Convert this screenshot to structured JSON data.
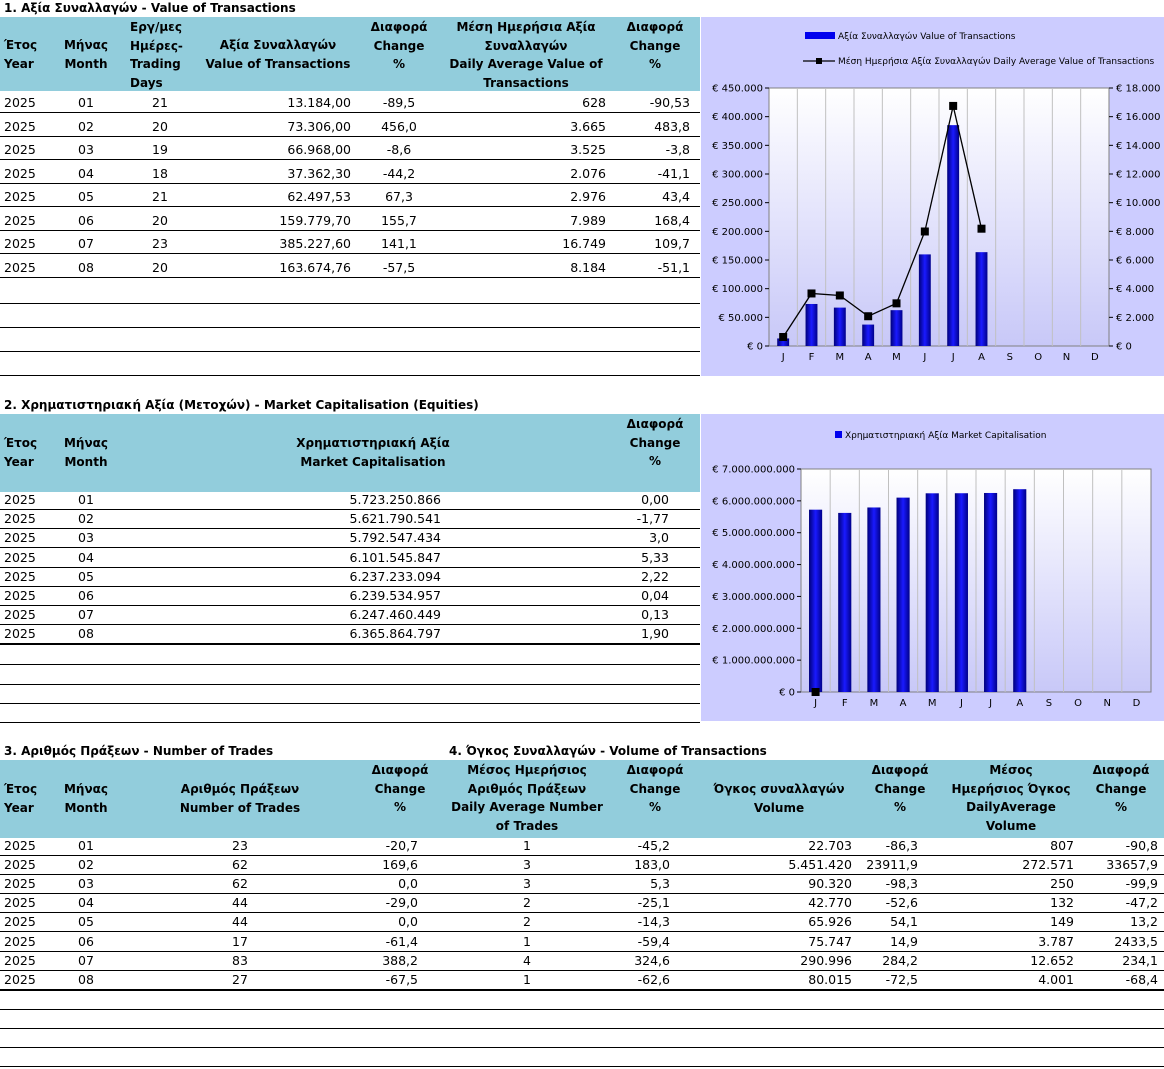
{
  "section1": {
    "title": "1. Αξία Συναλλαγών - Value of Transactions",
    "headers": {
      "year": "Έτος\nYear",
      "month": "Μήνας\nMonth",
      "days": "Εργ/μες\nΗμέρες-\nTrading\nDays",
      "value": "Αξία Συναλλαγών\nValue of Transactions",
      "change1": "Διαφορά\nChange\n%",
      "avg": "Μέση Ημερήσια Αξία\nΣυναλλαγών\nDaily Average Value of\nTransactions",
      "change2": "Διαφορά\nChange\n%"
    },
    "rows": [
      [
        "2025",
        "01",
        "21",
        "13.184,00",
        "-89,5",
        "628",
        "-90,53"
      ],
      [
        "2025",
        "02",
        "20",
        "73.306,00",
        "456,0",
        "3.665",
        "483,8"
      ],
      [
        "2025",
        "03",
        "19",
        "66.968,00",
        "-8,6",
        "3.525",
        "-3,8"
      ],
      [
        "2025",
        "04",
        "18",
        "37.362,30",
        "-44,2",
        "2.076",
        "-41,1"
      ],
      [
        "2025",
        "05",
        "21",
        "62.497,53",
        "67,3",
        "2.976",
        "43,4"
      ],
      [
        "2025",
        "06",
        "20",
        "159.779,70",
        "155,7",
        "7.989",
        "168,4"
      ],
      [
        "2025",
        "07",
        "23",
        "385.227,60",
        "141,1",
        "16.749",
        "109,7"
      ],
      [
        "2025",
        "08",
        "20",
        "163.674,76",
        "-57,5",
        "8.184",
        "-51,1"
      ]
    ]
  },
  "section2": {
    "title": "2. Χρηματιστηριακή Αξία (Μετοχών) - Market Capitalisation (Equities)",
    "headers": {
      "year": "Έτος\nYear",
      "month": "Μήνας\nMonth",
      "cap": "Χρηματιστηριακή Αξία\nMarket Capitalisation",
      "change": "Διαφορά\nChange\n%"
    },
    "rows": [
      [
        "2025",
        "01",
        "5.723.250.866",
        "0,00"
      ],
      [
        "2025",
        "02",
        "5.621.790.541",
        "-1,77"
      ],
      [
        "2025",
        "03",
        "5.792.547.434",
        "3,0"
      ],
      [
        "2025",
        "04",
        "6.101.545.847",
        "5,33"
      ],
      [
        "2025",
        "05",
        "6.237.233.094",
        "2,22"
      ],
      [
        "2025",
        "06",
        "6.239.534.957",
        "0,04"
      ],
      [
        "2025",
        "07",
        "6.247.460.449",
        "0,13"
      ],
      [
        "2025",
        "08",
        "6.365.864.797",
        "1,90"
      ]
    ]
  },
  "section3": {
    "title": "3. Αριθμός Πράξεων - Number of Trades",
    "headers": {
      "year": "Έτος\nYear",
      "month": "Μήνας\nMonth",
      "trades": "Αριθμός Πράξεων\nNumber of Trades",
      "change1": "Διαφορά\nChange\n%",
      "avg": "Μέσος Ημερήσιος\nΑριθμός Πράξεων\nDaily Average Number\nof Trades",
      "change2": "Διαφορά\nChange\n%"
    }
  },
  "section4": {
    "title": "4. Όγκος Συναλλαγών - Volume of Transactions",
    "headers": {
      "volume": "Όγκος συναλλαγών\nVolume",
      "change1": "Διαφορά\nChange\n%",
      "avg": "Μέσος\nΗμερήσιος Όγκος\nDailyAverage\nVolume",
      "change2": "Διαφορά\nChange\n%"
    }
  },
  "section34_rows": [
    [
      "2025",
      "01",
      "23",
      "-20,7",
      "1",
      "-45,2",
      "22.703",
      "-86,3",
      "807",
      "-90,8"
    ],
    [
      "2025",
      "02",
      "62",
      "169,6",
      "3",
      "183,0",
      "5.451.420",
      "23911,9",
      "272.571",
      "33657,9"
    ],
    [
      "2025",
      "03",
      "62",
      "0,0",
      "3",
      "5,3",
      "90.320",
      "-98,3",
      "250",
      "-99,9"
    ],
    [
      "2025",
      "04",
      "44",
      "-29,0",
      "2",
      "-25,1",
      "42.770",
      "-52,6",
      "132",
      "-47,2"
    ],
    [
      "2025",
      "05",
      "44",
      "0,0",
      "2",
      "-14,3",
      "65.926",
      "54,1",
      "149",
      "13,2"
    ],
    [
      "2025",
      "06",
      "17",
      "-61,4",
      "1",
      "-59,4",
      "75.747",
      "14,9",
      "3.787",
      "2433,5"
    ],
    [
      "2025",
      "07",
      "83",
      "388,2",
      "4",
      "324,6",
      "290.996",
      "284,2",
      "12.652",
      "234,1"
    ],
    [
      "2025",
      "08",
      "27",
      "-67,5",
      "1",
      "-62,6",
      "80.015",
      "-72,5",
      "4.001",
      "-68,4"
    ]
  ],
  "chart_data": [
    {
      "type": "bar",
      "categories": [
        "J",
        "F",
        "M",
        "A",
        "M",
        "J",
        "J",
        "A",
        "S",
        "O",
        "N",
        "D"
      ],
      "series": [
        {
          "name": "Αξία Συναλλαγών Value of Transactions",
          "type": "bar",
          "axis": "left",
          "values": [
            13184.0,
            73306.0,
            66968.0,
            37362.3,
            62497.53,
            159779.7,
            385227.6,
            163674.76,
            null,
            null,
            null,
            null
          ]
        },
        {
          "name": "Μέση Ημερήσια Αξία Συναλλαγών  Daily Average Value of Transactions",
          "type": "line",
          "axis": "right",
          "values": [
            628,
            3665,
            3525,
            2076,
            2976,
            7989,
            16749,
            8184,
            null,
            null,
            null,
            null
          ]
        }
      ],
      "ylim": [
        0,
        450000
      ],
      "y2lim": [
        0,
        18000
      ],
      "yticks": [
        "€ 0",
        "€ 50.000",
        "€ 100.000",
        "€ 150.000",
        "€ 200.000",
        "€ 250.000",
        "€ 300.000",
        "€ 350.000",
        "€ 400.000",
        "€ 450.000"
      ],
      "y2ticks": [
        "€ 0",
        "€ 2.000",
        "€ 4.000",
        "€ 6.000",
        "€ 8.000",
        "€ 10.000",
        "€ 12.000",
        "€ 14.000",
        "€ 16.000",
        "€ 18.000"
      ],
      "grid": true,
      "legend": "top"
    },
    {
      "type": "bar",
      "categories": [
        "J",
        "F",
        "M",
        "A",
        "M",
        "J",
        "J",
        "A",
        "S",
        "O",
        "N",
        "D"
      ],
      "series": [
        {
          "name": "Χρηματιστηριακή Αξία Market Capitalisation",
          "values": [
            5723250866,
            5621790541,
            5792547434,
            6101545847,
            6237233094,
            6239534957,
            6247460449,
            6365864797,
            null,
            null,
            null,
            null
          ]
        }
      ],
      "ylim": [
        0,
        7000000000
      ],
      "yticks": [
        "€ 0",
        "€ 1.000.000.000",
        "€ 2.000.000.000",
        "€ 3.000.000.000",
        "€ 4.000.000.000",
        "€ 5.000.000.000",
        "€ 6.000.000.000",
        "€ 7.000.000.000"
      ],
      "grid": true,
      "legend": "top"
    }
  ],
  "colors": {
    "header": "#92cddc",
    "chart_bg": "#ccccff",
    "bar": "#0000ee",
    "line": "#000000"
  }
}
